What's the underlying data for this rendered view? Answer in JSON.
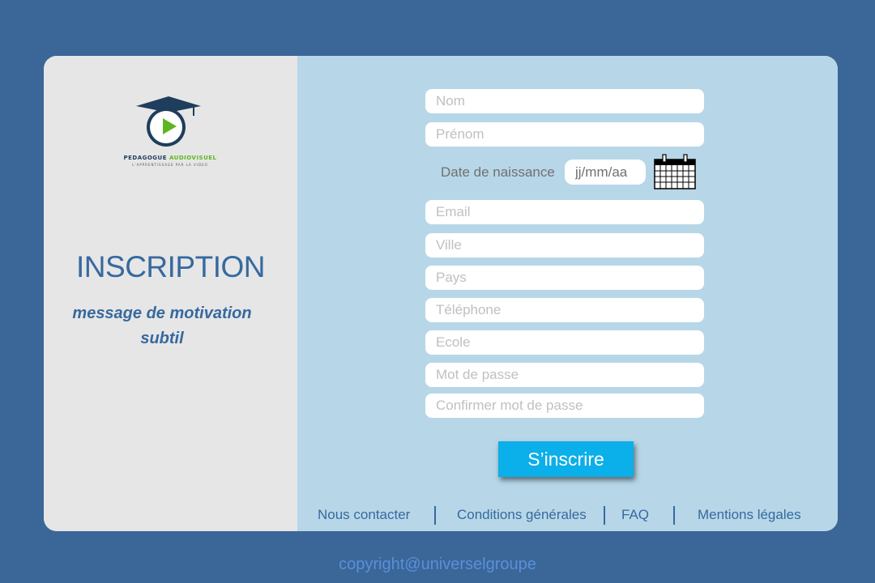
{
  "logo": {
    "brand_part1": "PEDAGOGUE",
    "brand_part2": "AUDIOVISUEL",
    "tagline": "L'APPRENTISSAGE PAR LA VIDEO"
  },
  "left": {
    "title": "INSCRIPTION",
    "motivation": "message de motivation subtil"
  },
  "form": {
    "nom_placeholder": "Nom",
    "prenom_placeholder": "Prénom",
    "dob_label": "Date de naissance",
    "dob_placeholder": "jj/mm/aa",
    "email_placeholder": "Email",
    "ville_placeholder": "Ville",
    "pays_placeholder": "Pays",
    "telephone_placeholder": "Téléphone",
    "ecole_placeholder": "Ecole",
    "password_placeholder": "Mot de passe",
    "confirm_password_placeholder": "Confirmer mot de passe",
    "submit_label": "S’inscrire",
    "calendar_icon": "calendar-icon"
  },
  "footer": {
    "contact": "Nous contacter",
    "conditions": "Conditions générales",
    "faq": "FAQ",
    "mentions": "Mentions légales"
  },
  "copyright": "copyright@universelgroupe",
  "colors": {
    "background": "#3a6698",
    "left_panel": "#e6e6e6",
    "right_panel": "#b7d7e8",
    "accent": "#36699f",
    "button": "#0bafe9",
    "logo_green": "#5fb521",
    "logo_navy": "#1f3d5c"
  }
}
